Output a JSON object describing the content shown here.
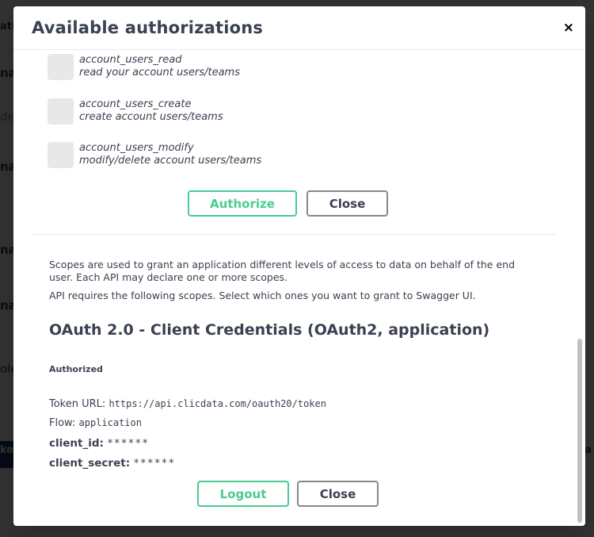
{
  "modal": {
    "title": "Available authorizations",
    "close_symbol": "×"
  },
  "background": {
    "fragments": [
      "ati",
      "na",
      "de",
      "na",
      "na",
      "na",
      "na",
      "ole"
    ],
    "bar_left_text": "ke",
    "bar_right_text": "a",
    "right_frag": "c"
  },
  "scopes": [
    {
      "name": "account_users_read",
      "description": "read your account users/teams"
    },
    {
      "name": "account_users_create",
      "description": "create account users/teams"
    },
    {
      "name": "account_users_modify",
      "description": "modify/delete account users/teams"
    }
  ],
  "first_section": {
    "authorize_label": "Authorize",
    "close_label": "Close"
  },
  "description": {
    "line1": "Scopes are used to grant an application different levels of access to data on behalf of the end user. Each API may declare one or more scopes.",
    "line2": "API requires the following scopes. Select which ones you want to grant to Swagger UI."
  },
  "client_credentials": {
    "title": "OAuth 2.0 - Client Credentials (OAuth2, application)",
    "authorized_label": "Authorized",
    "token_url_label": "Token URL:",
    "token_url": "https://api.clicdata.com/oauth20/token",
    "flow_label": "Flow:",
    "flow": "application",
    "client_id_label": "client_id:",
    "client_id": "******",
    "client_secret_label": "client_secret:",
    "client_secret": "******",
    "logout_label": "Logout",
    "close_label": "Close"
  },
  "colors": {
    "authorize_green": "#49cc90",
    "text": "#3b4151",
    "overlay": "#2e2f33"
  },
  "icons": {
    "close": "close-icon"
  }
}
